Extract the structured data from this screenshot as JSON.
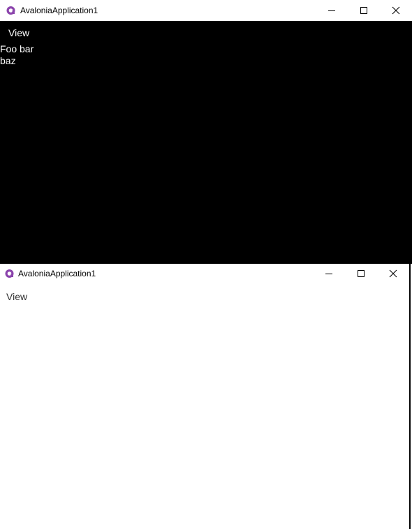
{
  "windows": [
    {
      "id": "dark",
      "title": "AvaloniaApplication1",
      "menu": [
        "View"
      ],
      "content_lines": [
        "Foo bar",
        "baz"
      ],
      "theme": "dark"
    },
    {
      "id": "light",
      "title": "AvaloniaApplication1",
      "menu": [
        "View"
      ],
      "theme": "light"
    }
  ],
  "icons": {
    "app": "avalonia-logo-icon",
    "minimize": "minimize-icon",
    "maximize": "maximize-icon",
    "close": "close-icon"
  },
  "colors": {
    "dark_background": "#000000",
    "light_background": "#ffffff",
    "avalonia_purple": "#8b44ac"
  }
}
